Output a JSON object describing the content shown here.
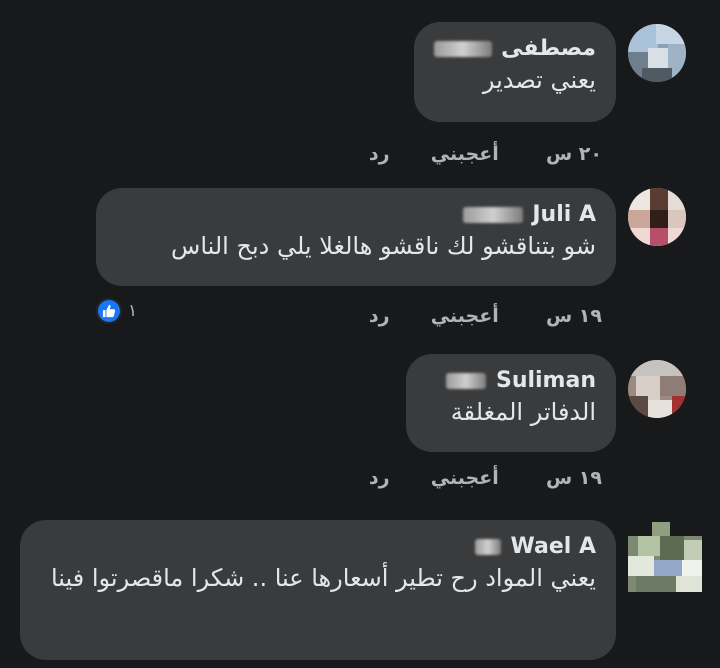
{
  "comments": [
    {
      "author": "مصطفى",
      "text": "يعني تصدير",
      "time": "٢٠ س",
      "like_label": "أعجبني",
      "reply_label": "رد",
      "reactions": ""
    },
    {
      "author": "Juli A",
      "text": "شو بتناقشو لك ناقشو هالغلا يلي دبح الناس",
      "time": "١٩ س",
      "like_label": "أعجبني",
      "reply_label": "رد",
      "reactions": "١"
    },
    {
      "author": "Suliman",
      "text": "الدفاتر المغلقة",
      "time": "١٩ س",
      "like_label": "أعجبني",
      "reply_label": "رد",
      "reactions": ""
    },
    {
      "author": "Wael A",
      "text": "يعني المواد رح تطير أسعارها عنا .. شكرا ماقصرتوا فينا",
      "time": "",
      "like_label": "",
      "reply_label": "",
      "reactions": ""
    }
  ],
  "colors": {
    "background": "#18191a",
    "bubble": "#3a3b3c",
    "text": "#e4e6eb",
    "secondary": "#b0b3b8",
    "like_blue": "#1877f2"
  },
  "icons": {
    "reaction": "thumbs-up-icon"
  }
}
